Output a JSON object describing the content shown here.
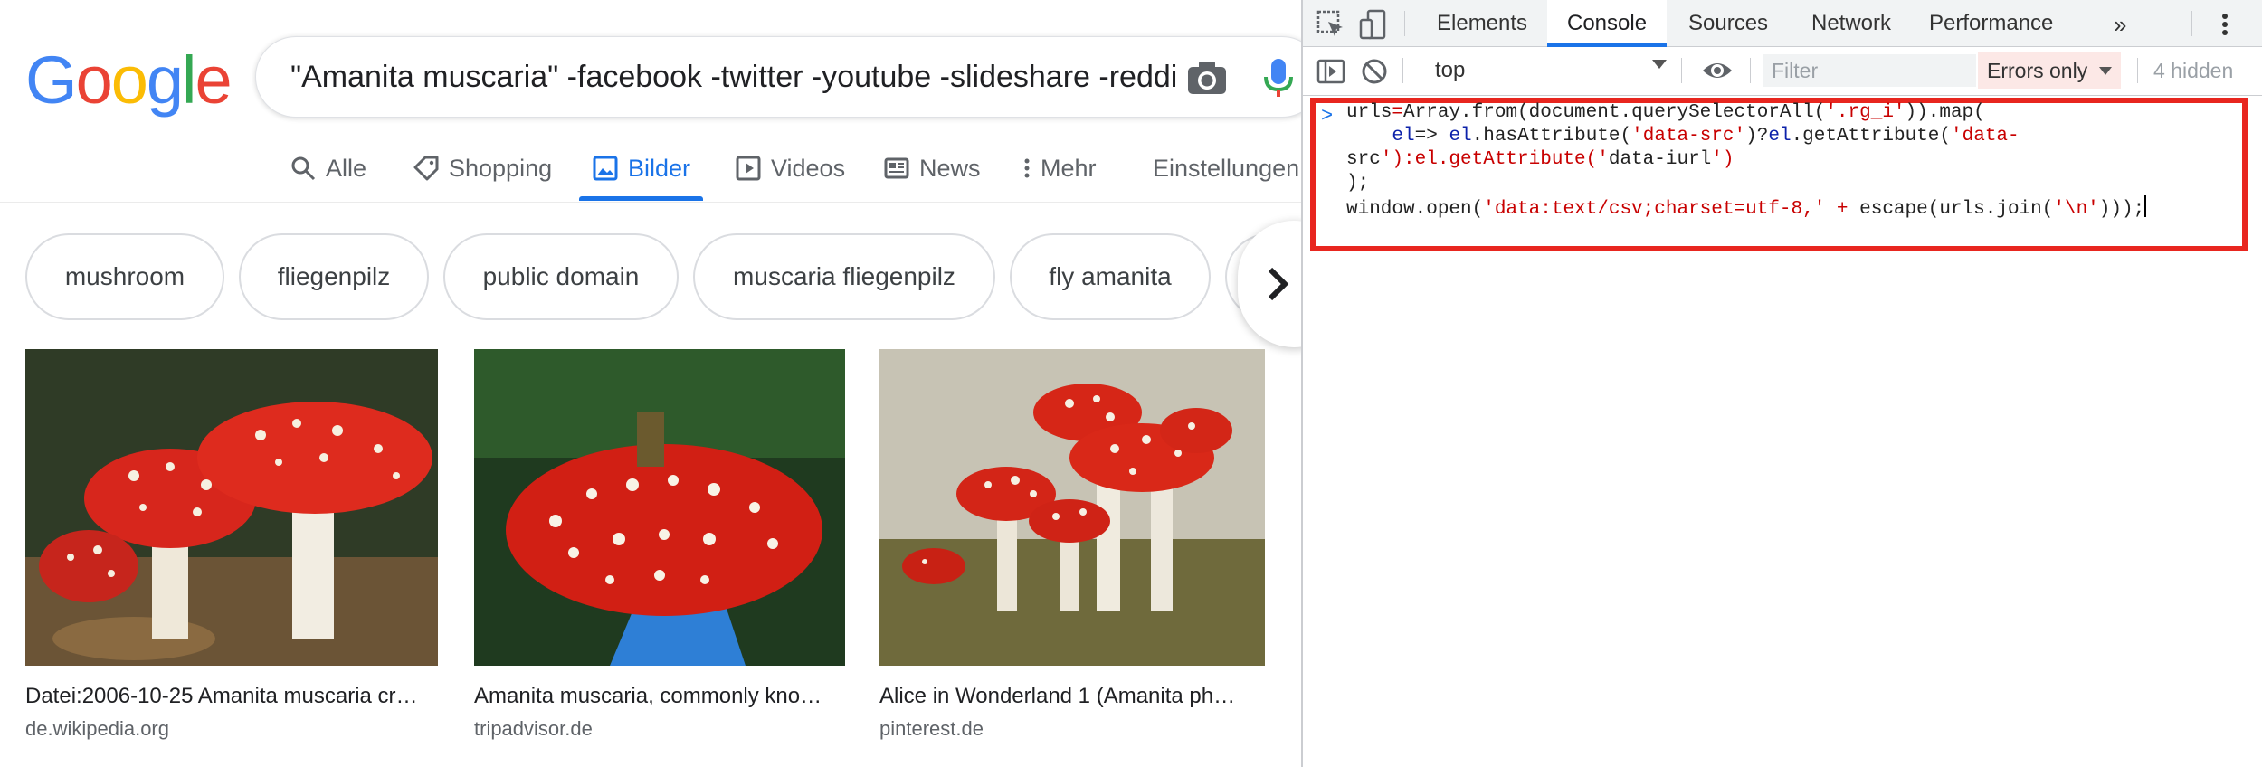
{
  "google": {
    "logo": [
      "G",
      "o",
      "o",
      "g",
      "l",
      "e"
    ],
    "logo_colors": [
      "#4285F4",
      "#EA4335",
      "#FBBC05",
      "#4285F4",
      "#34A853",
      "#EA4335"
    ],
    "query": "\"Amanita muscaria\" -facebook -twitter -youtube -slideshare -reddit",
    "tabs": [
      {
        "label": "Alle",
        "icon": "search-icon"
      },
      {
        "label": "Shopping",
        "icon": "tag-icon"
      },
      {
        "label": "Bilder",
        "icon": "image-icon",
        "active": true
      },
      {
        "label": "Videos",
        "icon": "play-icon"
      },
      {
        "label": "News",
        "icon": "news-icon"
      },
      {
        "label": "Mehr",
        "icon": "more-vert-icon"
      },
      {
        "label": "Einstellungen"
      }
    ],
    "chips": [
      "mushroom",
      "fliegenpilz",
      "public domain",
      "muscaria fliegenpilz",
      "fly amanita"
    ],
    "results": [
      {
        "title": "Datei:2006-10-25 Amanita muscaria cr…",
        "source": "de.wikipedia.org"
      },
      {
        "title": "Amanita muscaria, commonly kno…",
        "source": "tripadvisor.de"
      },
      {
        "title": "Alice in Wonderland 1 (Amanita ph…",
        "source": "pinterest.de"
      }
    ],
    "accent": "#1a73e8"
  },
  "devtools": {
    "tabs": [
      "Elements",
      "Console",
      "Sources",
      "Network",
      "Performance"
    ],
    "active_tab": "Console",
    "more": "»",
    "context": "top",
    "filter_placeholder": "Filter",
    "levels": "Errors only",
    "hidden": "4 hidden",
    "prompt": ">",
    "code_lines": [
      "urls=Array.from(document.querySelectorAll('.rg_i')).map(",
      "    el=> el.hasAttribute('data-src')?el.getAttribute('data-",
      "src'):el.getAttribute('data-iurl')",
      ");",
      "window.open('data:text/csv;charset=utf-8,' + escape(urls.join('\\n')));"
    ],
    "highlight_color": "#e8261f"
  }
}
